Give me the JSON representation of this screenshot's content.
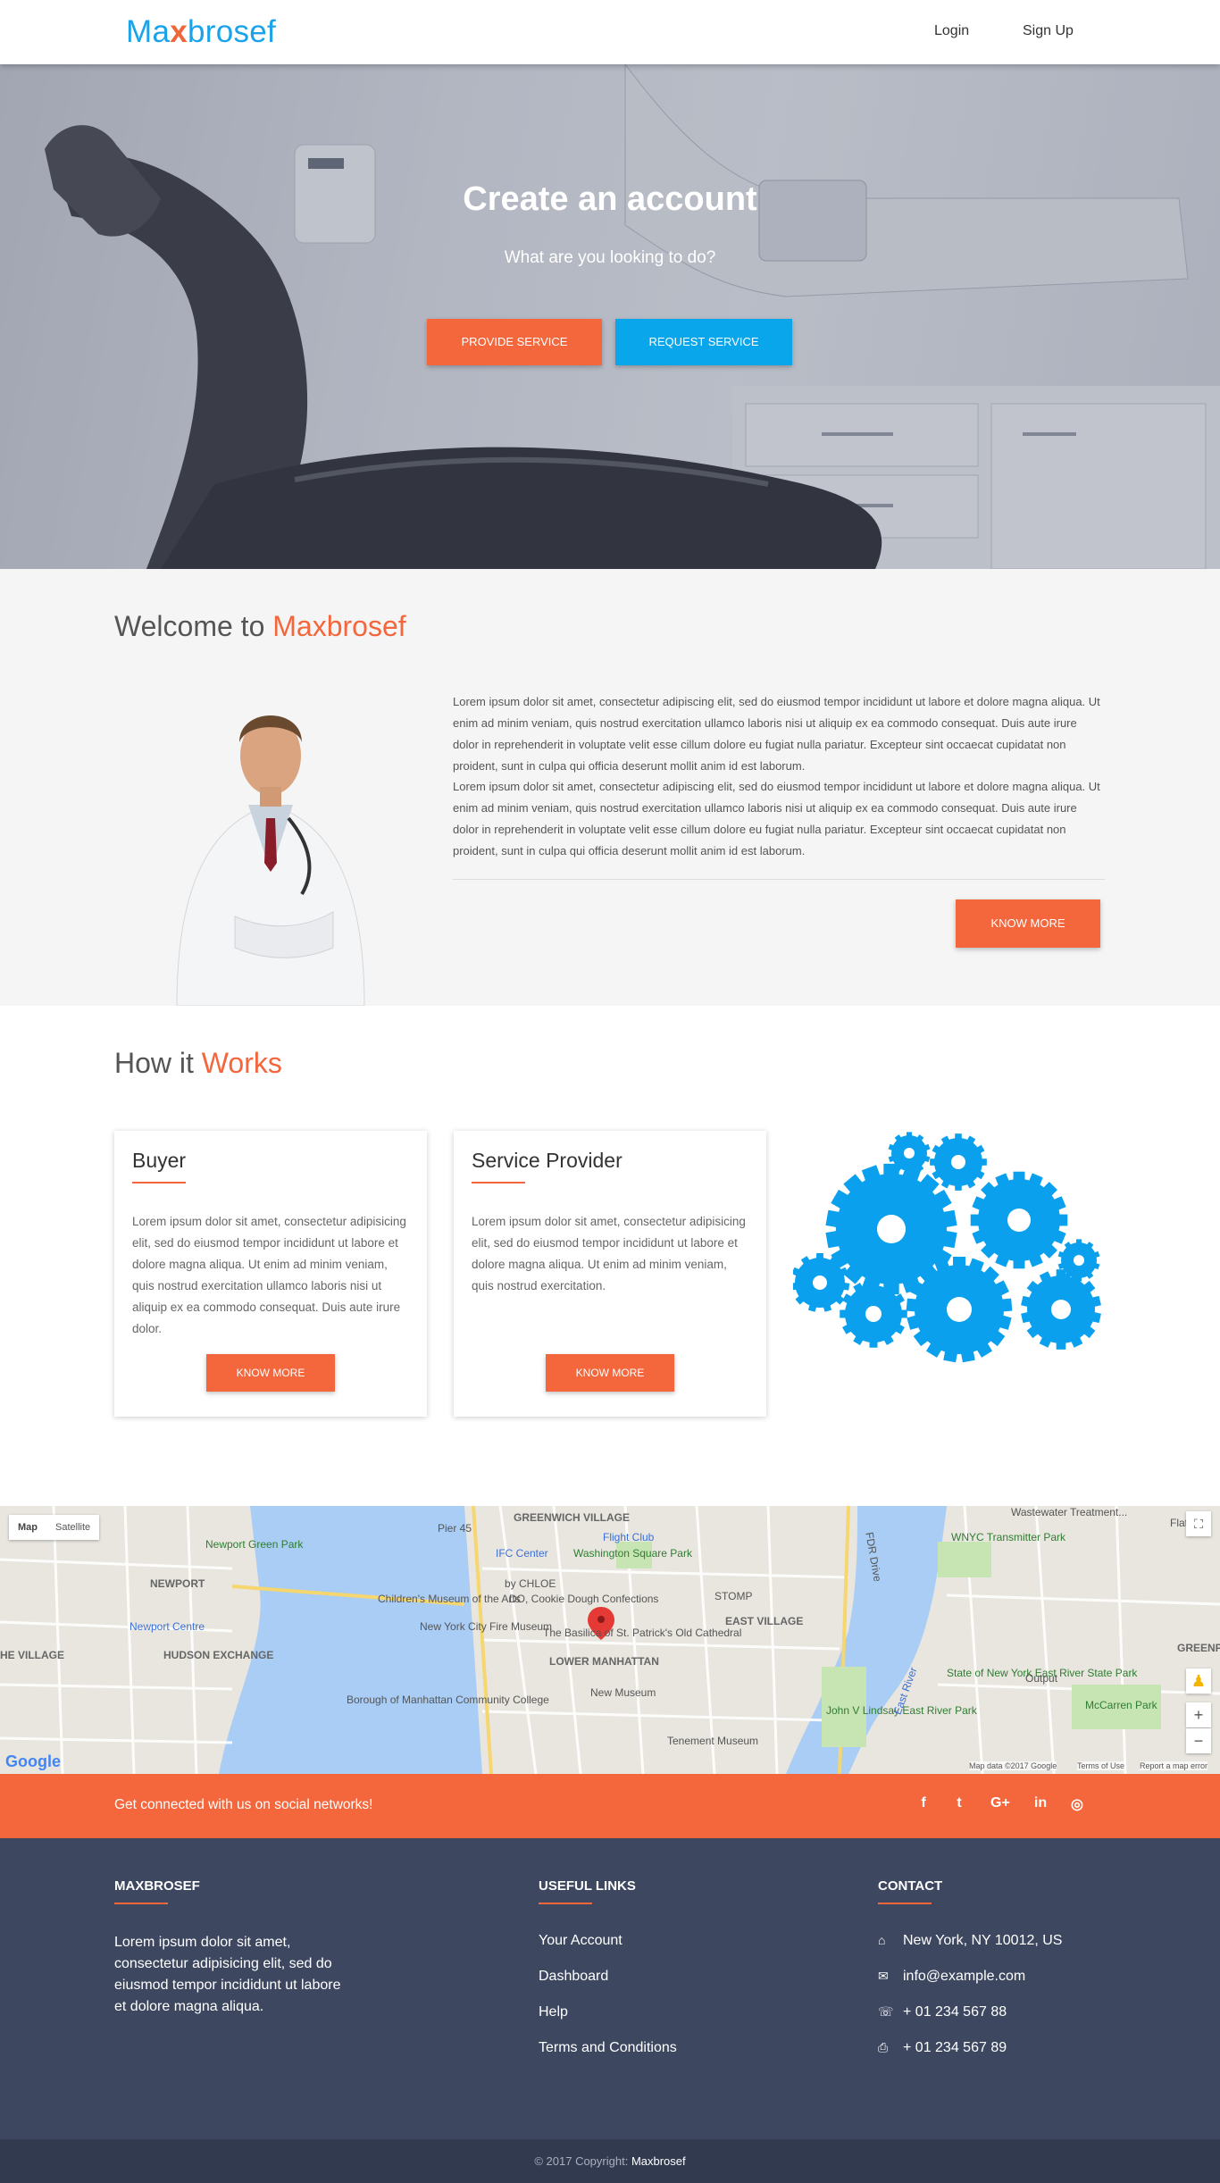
{
  "nav": {
    "logo_pre": "Ma",
    "logo_x": "x",
    "logo_post": "brosef",
    "login": "Login",
    "signup": "Sign Up"
  },
  "hero": {
    "title": "Create an account",
    "subtitle": "What are you looking to do?",
    "provide_btn": "PROVIDE SERVICE",
    "request_btn": "REQUEST SERVICE"
  },
  "welcome": {
    "title_pre": "Welcome to ",
    "title_accent": "Maxbrosef",
    "para1": "Lorem ipsum dolor sit amet, consectetur adipiscing elit, sed do eiusmod tempor incididunt ut labore et dolore magna aliqua. Ut enim ad minim veniam, quis nostrud exercitation ullamco laboris nisi ut aliquip ex ea commodo consequat. Duis aute irure dolor in reprehenderit in voluptate velit esse cillum dolore eu fugiat nulla pariatur. Excepteur sint occaecat cupidatat non proident, sunt in culpa qui officia deserunt mollit anim id est laborum.",
    "para2": "Lorem ipsum dolor sit amet, consectetur adipiscing elit, sed do eiusmod tempor incididunt ut labore et dolore magna aliqua. Ut enim ad minim veniam, quis nostrud exercitation ullamco laboris nisi ut aliquip ex ea commodo consequat. Duis aute irure dolor in reprehenderit in voluptate velit esse cillum dolore eu fugiat nulla pariatur. Excepteur sint occaecat cupidatat non proident, sunt in culpa qui officia deserunt mollit anim id est laborum.",
    "know_more": "KNOW MORE"
  },
  "how": {
    "title_pre": "How it ",
    "title_accent": "Works",
    "buyer": {
      "title": "Buyer",
      "text": "Lorem ipsum dolor sit amet, consectetur adipisicing elit, sed do eiusmod tempor incididunt ut labore et dolore magna aliqua. Ut enim ad minim veniam, quis nostrud exercitation ullamco laboris nisi ut aliquip ex ea commodo consequat. Duis aute irure dolor.",
      "button": "KNOW MORE"
    },
    "provider": {
      "title": "Service Provider",
      "text": "Lorem ipsum dolor sit amet, consectetur adipisicing elit, sed do eiusmod tempor incididunt ut labore et dolore magna aliqua. Ut enim ad minim veniam, quis nostrud exercitation.",
      "button": "KNOW MORE"
    }
  },
  "map": {
    "type_map": "Map",
    "type_satellite": "Satellite",
    "labels": {
      "greenwich": "GREENWICH VILLAGE",
      "flatiron": "Flatiron",
      "wastewater": "Wastewater Treatment...",
      "pier": "Pier 45",
      "flight": "Flight Club",
      "ifc": "IFC Center",
      "washington": "Washington Square Park",
      "wnyc": "WNYC Transmitter Park",
      "newport_green": "Newport Green Park",
      "newport": "NEWPORT",
      "chloe": "by CHLOE",
      "stomp": "STOMP",
      "childrens": "Children's Museum of the Arts",
      "cookie": "DO, Cookie Dough Confections",
      "newport_centre": "Newport Centre",
      "firemuseum": "New York City Fire Museum",
      "basilica": "The Basilica of St. Patrick's Old Cathedral",
      "eastvillage": "EAST VILLAGE",
      "hudson": "HUDSON EXCHANGE",
      "lowermanhattan": "LOWER MANHATTAN",
      "greenpoint": "GREENPOINT",
      "thevillage": "HE VILLAGE",
      "newmuseum": "New Museum",
      "statepark": "State of New York East River State Park",
      "output": "Output",
      "bmcc": "Borough of Manhattan Community College",
      "lindsay": "John V Lindsay East River Park",
      "mccarren": "McCarren Park",
      "tenement": "Tenement Museum",
      "fdr": "FDR Drive",
      "eastriver": "East River",
      "google": "Google",
      "attrib": "Map data ©2017 Google",
      "terms": "Terms of Use",
      "report": "Report a map error"
    }
  },
  "social": {
    "text": "Get connected with us on social networks!",
    "icons": [
      "f",
      "t",
      "G+",
      "in",
      "◎"
    ]
  },
  "footer": {
    "brand_title": "MAXBROSEF",
    "brand_text": "Lorem ipsum dolor sit amet, consectetur adipisicing elit, sed do eiusmod tempor incididunt ut labore et dolore magna aliqua.",
    "links_title": "USEFUL LINKS",
    "links": [
      "Your Account",
      "Dashboard",
      "Help",
      "Terms and Conditions"
    ],
    "contact_title": "CONTACT",
    "address": "New York, NY 10012, US",
    "email": "info@example.com",
    "phone": "+ 01 234 567 88",
    "fax": "+ 01 234 567 89"
  },
  "copyright": {
    "pre": "© 2017 Copyright: ",
    "brand": "Maxbrosef"
  }
}
